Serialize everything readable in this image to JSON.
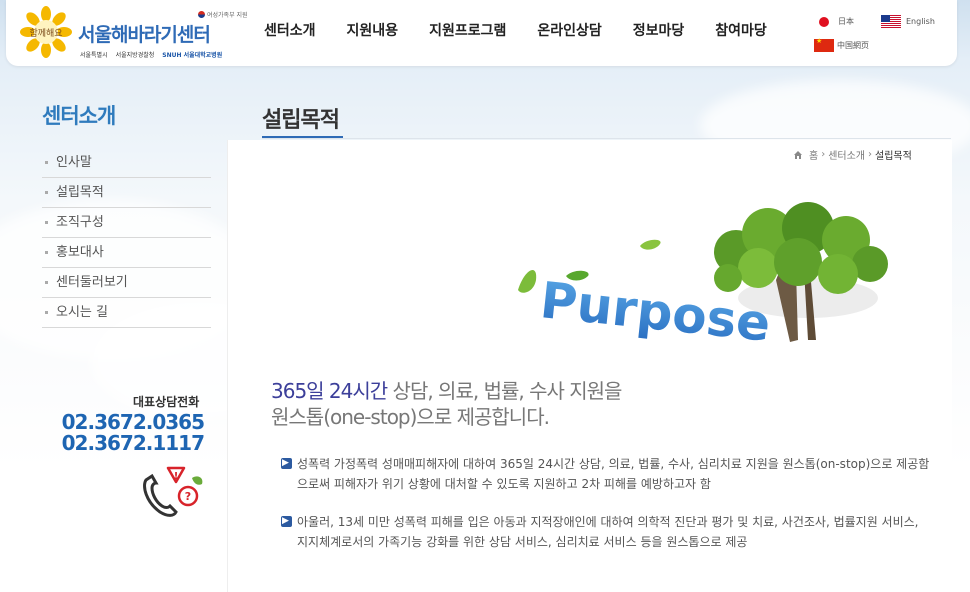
{
  "header": {
    "logo_title": "서울해바라기센터",
    "logo_badge": "함께해요",
    "gov_label": "여성가족부 지원",
    "partners": [
      "서울특별시",
      "서울지방경찰청",
      "SNUH 서울대학교병원"
    ]
  },
  "gnb": [
    "센터소개",
    "지원내용",
    "지원프로그램",
    "온라인상담",
    "정보마당",
    "참여마당"
  ],
  "languages": {
    "japanese": "日本",
    "english": "English",
    "chinese": "中国網页"
  },
  "sidebar": {
    "title": "센터소개",
    "items": [
      "인사말",
      "설립목적",
      "조직구성",
      "홍보대사",
      "센터둘러보기",
      "오시는 길"
    ],
    "phone_label": "대표상담전화",
    "phone_numbers": [
      "02.3672.0365",
      "02.3672.1117"
    ]
  },
  "page": {
    "title": "설립목적",
    "breadcrumb": [
      "홈",
      "센터소개",
      "설립목적"
    ],
    "image_text": "Purpose",
    "slogan_hl": "365일 24시간",
    "slogan_rest": " 상담, 의료, 법률, 수사 지원을",
    "slogan_line2": "원스톱(one-stop)으로 제공합니다.",
    "paragraphs": [
      "성폭력 가정폭력 성매매피해자에 대하여 365일 24시간 상담, 의료, 법률, 수사, 심리치료 지원을 원스톱(on-stop)으로 제공함으로써 피해자가 위기 상황에 대처할 수 있도록 지원하고 2차 피해를 예방하고자 함",
      "아울러, 13세 미만 성폭력 피해를 입은 아동과 지적장애인에 대하여 의학적 진단과 평가 및 치료, 사건조사, 법률지원 서비스, 지지체계로서의 가족기능 강화를 위한 상담 서비스, 심리치료 서비스 등을 원스톱으로 제공"
    ]
  },
  "colors": {
    "brand_blue": "#2f6bb6",
    "accent_navy": "#3c3f9a",
    "phone_blue": "#1e65b2"
  }
}
